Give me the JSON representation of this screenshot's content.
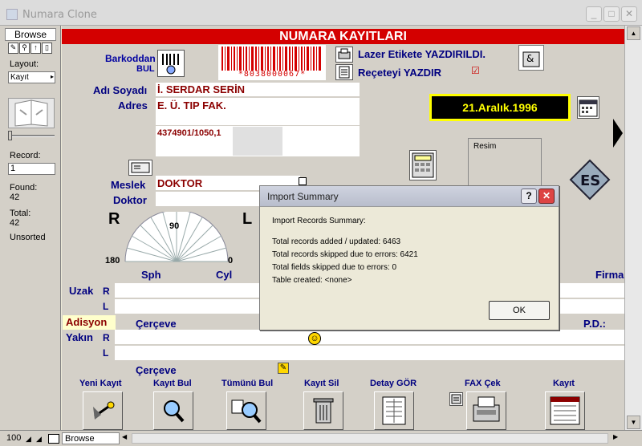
{
  "window": {
    "title": "Numara Clone"
  },
  "status_area": {
    "mode": "Browse",
    "layout_label": "Layout:",
    "layout_value": "Kayıt",
    "record_label": "Record:",
    "record_value": "1",
    "found_label": "Found:",
    "found_value": "42",
    "total_label": "Total:",
    "total_value": "42",
    "sort_status": "Unsorted"
  },
  "form": {
    "header": "NUMARA KAYITLARI",
    "barcode_label": "Barkoddan",
    "barcode_bul": "BUL",
    "barcode_digits": "*8038000067*",
    "laser_label": "Lazer Etikete YAZDIRILDI.",
    "recipe_label": "Reçeteyi YAZDIR",
    "name_label": "Adı Soyadı",
    "name_value": "İ. SERDAR SERİN",
    "address_label": "Adres",
    "address_value": "E. Ü.  TIP FAK.",
    "phone_value": "4374901/1050,1",
    "date_value": "21.Aralık.1996",
    "picture_label": "Resim",
    "profession_label": "Meslek",
    "profession_value": "DOKTOR",
    "doctor_label": "Doktor",
    "right_label": "R",
    "left_label": "L",
    "protractor_90": "90",
    "protractor_180": "180",
    "protractor_0": "0",
    "sph_label": "Sph",
    "cyl_label": "Cyl",
    "firma_label": "Firma",
    "uzak_label": "Uzak",
    "row_r": "R",
    "row_l": "L",
    "adisyon_label": "Adisyon",
    "cerceve_label": "Çerçeve",
    "pd_label": "P.D.:",
    "yakin_label": "Yakın"
  },
  "toolbar": {
    "new_record": "Yeni Kayıt",
    "find_record": "Kayıt Bul",
    "find_all": "Tümünü Bul",
    "delete_record": "Kayıt Sil",
    "view_detail": "Detay GÖR",
    "fax": "FAX Çek",
    "record": "Kayıt"
  },
  "bottom_bar": {
    "zoom": "100",
    "mode": "Browse"
  },
  "dialog": {
    "title": "Import Summary",
    "heading": "Import Records Summary:",
    "added": "Total records added / updated: 6463",
    "skipped": "Total records skipped due to errors: 6421",
    "fields_skipped": "Total fields skipped due to errors: 0",
    "table_created": "Table created: <none>",
    "ok_label": "OK",
    "help_label": "?",
    "close_label": "✕"
  },
  "colors": {
    "header_red": "#d40000",
    "date_bg": "#000000",
    "date_border": "#ffff00",
    "date_text": "#ffff00"
  }
}
